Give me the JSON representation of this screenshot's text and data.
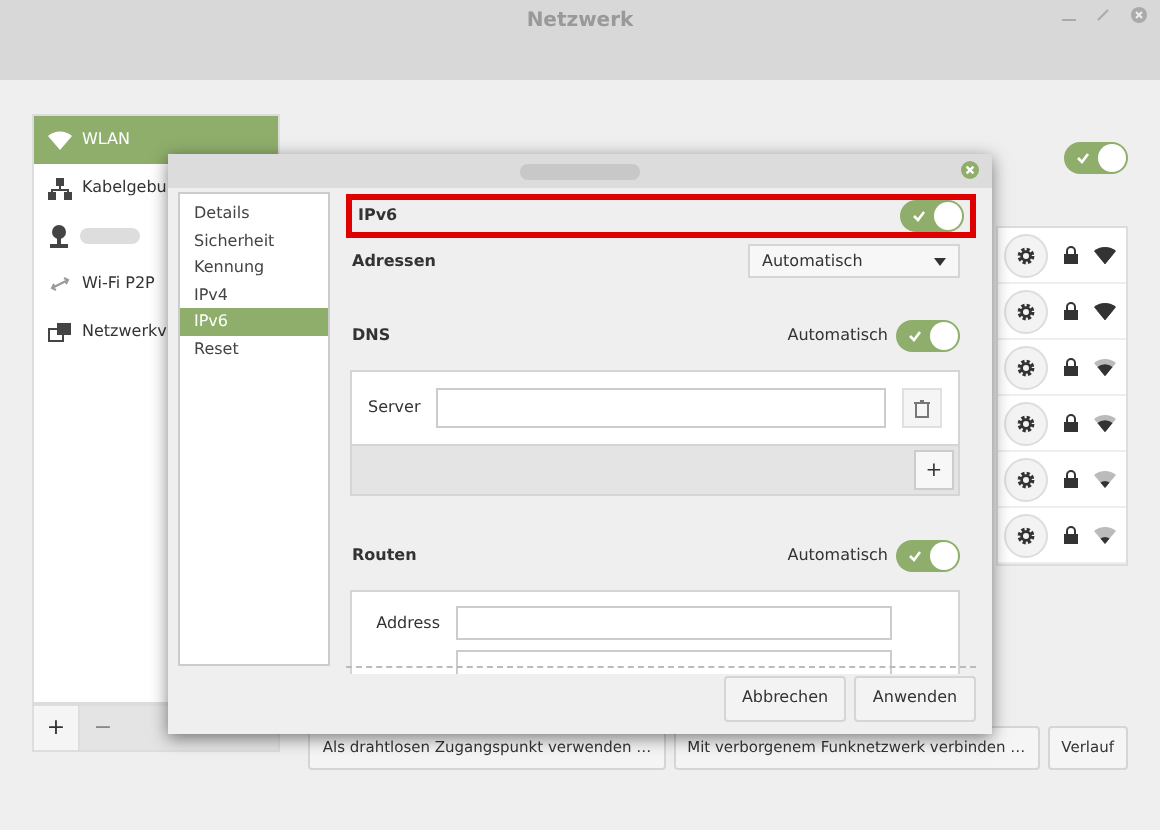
{
  "window": {
    "title": "Netzwerk"
  },
  "sidebar": {
    "items": [
      {
        "label": "WLAN",
        "selected": true
      },
      {
        "label": "Kabelgebu",
        "selected": false
      },
      {
        "selected": false
      },
      {
        "label": "Wi-Fi P2P",
        "selected": false
      },
      {
        "label": "Netzwerkv",
        "selected": false
      }
    ]
  },
  "wlan_switch": {
    "on": true
  },
  "list_buttons": [
    "+",
    "−"
  ],
  "bottom_buttons": [
    "Als drahtlosen Zugangspunkt verwenden …",
    "Mit verborgenem Funknetzwerk verbinden …",
    "Verlauf"
  ],
  "dialog": {
    "nav": [
      {
        "label": "Details",
        "selected": false
      },
      {
        "label": "Sicherheit",
        "selected": false
      },
      {
        "label": "Kennung",
        "selected": false
      },
      {
        "label": "IPv4",
        "selected": false
      },
      {
        "label": "IPv6",
        "selected": true
      },
      {
        "label": "Reset",
        "selected": false
      }
    ],
    "ipv6": {
      "label": "IPv6",
      "on": true,
      "highlighted": true
    },
    "addresses": {
      "label": "Adressen",
      "value": "Automatisch"
    },
    "dns": {
      "label": "DNS",
      "auto_label": "Automatisch",
      "on": true,
      "server_label": "Server",
      "add": "+"
    },
    "routes": {
      "label": "Routen",
      "auto_label": "Automatisch",
      "on": true,
      "address_label": "Address"
    },
    "buttons": [
      "Abbrechen",
      "Anwenden"
    ]
  }
}
